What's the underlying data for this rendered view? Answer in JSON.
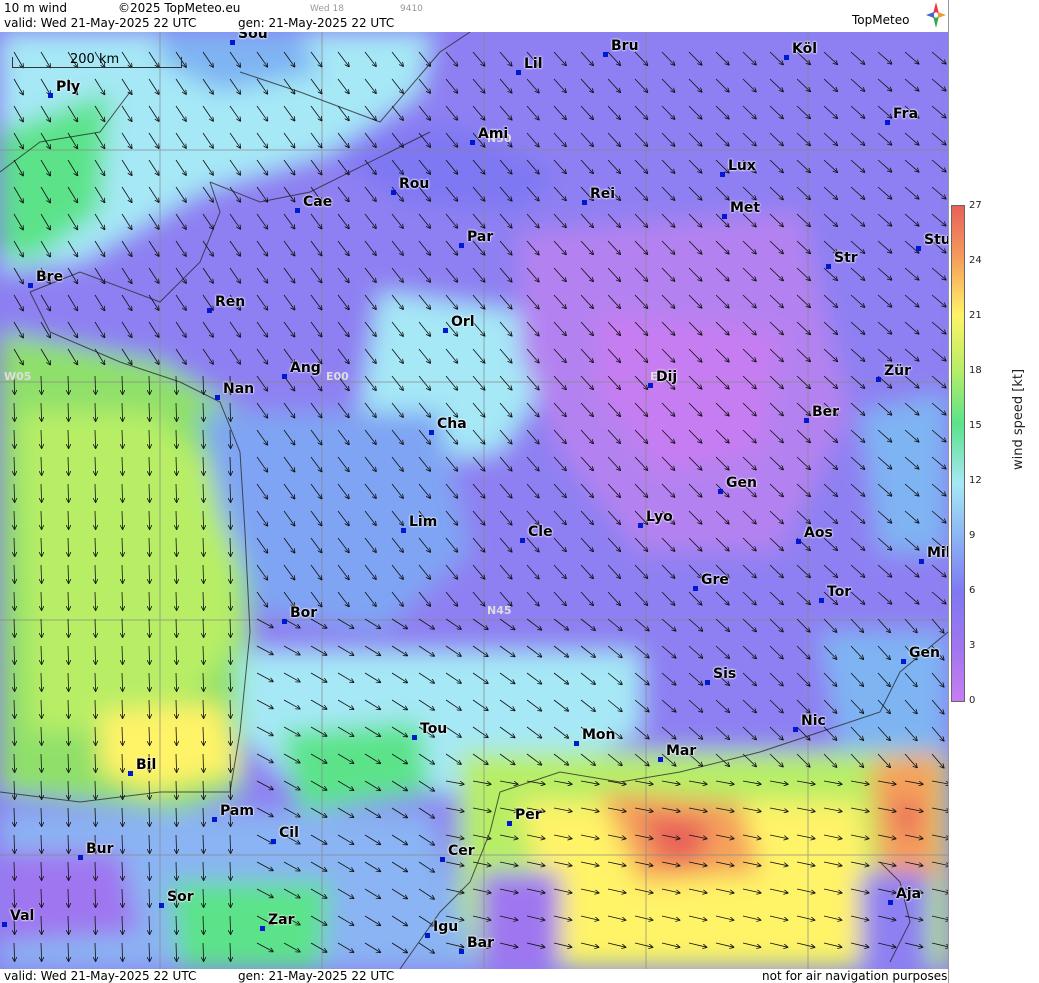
{
  "header": {
    "title": "10 m wind",
    "copyright": "©2025 TopMeteo.eu",
    "day_code": "Wed 18",
    "run_code": "9410",
    "valid": "valid:  Wed  21-May-2025  22 UTC",
    "gen": "gen: 21-May-2025  22 UTC",
    "logo": "TopMeteo"
  },
  "footer": {
    "valid": "valid:  Wed  21-May-2025  22 UTC",
    "gen": "gen: 21-May-2025  22 UTC",
    "note": "not for air navigation purposes"
  },
  "scale_label": "200 km",
  "legend": {
    "unit_label": "wind speed [kt]",
    "ticks": [
      "27",
      "24",
      "21",
      "18",
      "15",
      "12",
      "9",
      "6",
      "3",
      "0"
    ]
  },
  "grid_labels": [
    "N50",
    "N45",
    "W05",
    "E00",
    "E05"
  ],
  "cities": [
    {
      "name": "Sou"
    },
    {
      "name": "Lil"
    },
    {
      "name": "Bru"
    },
    {
      "name": "Köl"
    },
    {
      "name": "Ply"
    },
    {
      "name": "Ami"
    },
    {
      "name": "Fra"
    },
    {
      "name": "Lux"
    },
    {
      "name": "Rou"
    },
    {
      "name": "Cae"
    },
    {
      "name": "Rei"
    },
    {
      "name": "Met"
    },
    {
      "name": "Par"
    },
    {
      "name": "Stu"
    },
    {
      "name": "Str"
    },
    {
      "name": "Bre"
    },
    {
      "name": "Ren"
    },
    {
      "name": "Orl"
    },
    {
      "name": "Ang"
    },
    {
      "name": "Dij"
    },
    {
      "name": "Zür"
    },
    {
      "name": "Nan"
    },
    {
      "name": "Cha"
    },
    {
      "name": "Ber"
    },
    {
      "name": "Gen"
    },
    {
      "name": "Lim"
    },
    {
      "name": "Cle"
    },
    {
      "name": "Lyo"
    },
    {
      "name": "Aos"
    },
    {
      "name": "Mil"
    },
    {
      "name": "Gre"
    },
    {
      "name": "Tor"
    },
    {
      "name": "Bor"
    },
    {
      "name": "Gen"
    },
    {
      "name": "Sis"
    },
    {
      "name": "Nic"
    },
    {
      "name": "Mon"
    },
    {
      "name": "Tou"
    },
    {
      "name": "Mar"
    },
    {
      "name": "Bil"
    },
    {
      "name": "Pam"
    },
    {
      "name": "Per"
    },
    {
      "name": "Cil"
    },
    {
      "name": "Bur"
    },
    {
      "name": "Cer"
    },
    {
      "name": "Aja"
    },
    {
      "name": "Sor"
    },
    {
      "name": "Val"
    },
    {
      "name": "Zar"
    },
    {
      "name": "Igu"
    },
    {
      "name": "Bar"
    }
  ]
}
